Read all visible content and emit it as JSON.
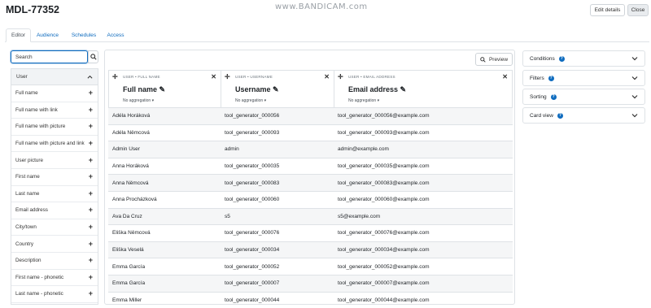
{
  "watermark": "www.BANDICAM.com",
  "page": {
    "title": "MDL-77352"
  },
  "header": {
    "edit_label": "Edit details",
    "close_label": "Close"
  },
  "tabs": [
    {
      "label": "Editor"
    },
    {
      "label": "Audience"
    },
    {
      "label": "Schedules"
    },
    {
      "label": "Access"
    }
  ],
  "search": {
    "placeholder": "Search"
  },
  "sidebar": {
    "group_label": "User",
    "items": [
      {
        "label": "Full name"
      },
      {
        "label": "Full name with link"
      },
      {
        "label": "Full name with picture"
      },
      {
        "label": "Full name with picture and link"
      },
      {
        "label": "User picture"
      },
      {
        "label": "First name"
      },
      {
        "label": "Last name"
      },
      {
        "label": "Email address"
      },
      {
        "label": "City/town"
      },
      {
        "label": "Country"
      },
      {
        "label": "Description"
      },
      {
        "label": "First name - phonetic"
      },
      {
        "label": "Last name - phonetic"
      }
    ]
  },
  "preview_label": "Preview",
  "columns": [
    {
      "kicker": "User • Full name",
      "name": "Full name",
      "aggregation": "No aggregation"
    },
    {
      "kicker": "User • Username",
      "name": "Username",
      "aggregation": "No aggregation"
    },
    {
      "kicker": "User • Email address",
      "name": "Email address",
      "aggregation": "No aggregation"
    }
  ],
  "rows": [
    [
      "Adéla Horáková",
      "tool_generator_000056",
      "tool_generator_000056@example.com"
    ],
    [
      "Adéla Němcová",
      "tool_generator_000093",
      "tool_generator_000093@example.com"
    ],
    [
      "Admin User",
      "admin",
      "admin@example.com"
    ],
    [
      "Anna Horáková",
      "tool_generator_000035",
      "tool_generator_000035@example.com"
    ],
    [
      "Anna Němcová",
      "tool_generator_000083",
      "tool_generator_000083@example.com"
    ],
    [
      "Anna Procházková",
      "tool_generator_000060",
      "tool_generator_000060@example.com"
    ],
    [
      "Ava Da Cruz",
      "s5",
      "s5@example.com"
    ],
    [
      "Eliška Němcová",
      "tool_generator_000076",
      "tool_generator_000076@example.com"
    ],
    [
      "Eliška Veselá",
      "tool_generator_000034",
      "tool_generator_000034@example.com"
    ],
    [
      "Emma García",
      "tool_generator_000052",
      "tool_generator_000052@example.com"
    ],
    [
      "Emma García",
      "tool_generator_000007",
      "tool_generator_000007@example.com"
    ],
    [
      "Emma Miller",
      "tool_generator_000044",
      "tool_generator_000044@example.com"
    ]
  ],
  "panels": [
    {
      "label": "Conditions"
    },
    {
      "label": "Filters"
    },
    {
      "label": "Sorting"
    },
    {
      "label": "Card view"
    }
  ],
  "colors": {
    "accent": "#0f6cbf",
    "border": "#dee2e6",
    "stripe": "#f5f6f7"
  }
}
